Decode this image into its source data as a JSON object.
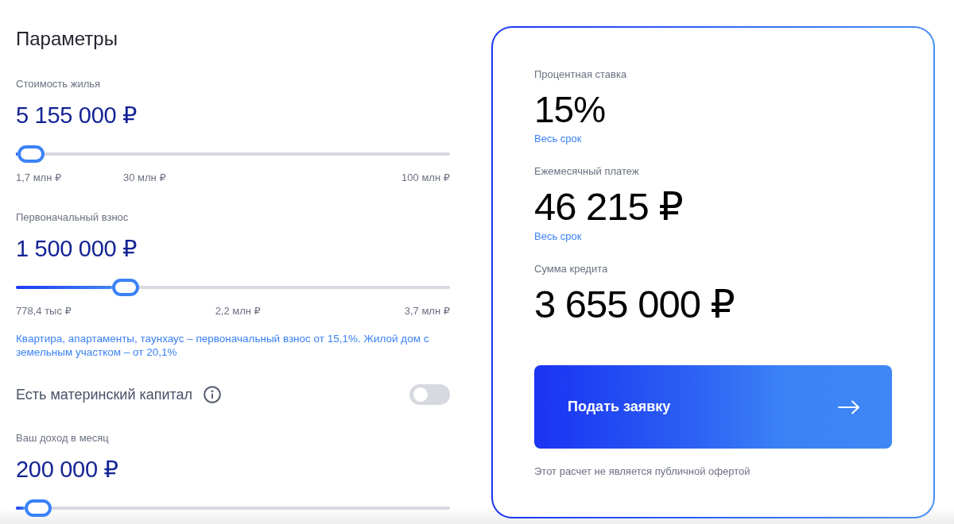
{
  "parameters": {
    "title": "Параметры",
    "items": [
      {
        "kind": "slider",
        "label": "Стоимость жилья",
        "value": "5 155 000 ₽",
        "level": 0.035,
        "ticks": [
          "1,7 млн ₽",
          "30 млн ₽",
          "100 млн ₽"
        ]
      },
      {
        "kind": "slider",
        "label": "Первоначальный взнос",
        "value": "1 500 000 ₽",
        "level": 0.253,
        "ticks": [
          "778,4 тыс ₽",
          "2,2 млн ₽",
          "3,7 млн ₽"
        ],
        "note": "Квартира, апартаменты, таунхаус – первоначальный взнос от 15,1%. Жилой дом с земельным участком – от 20,1%"
      },
      {
        "kind": "toggle",
        "label": "Есть материнский капитал",
        "on": false
      },
      {
        "kind": "slider",
        "label": "Ваш доход в месяц",
        "value": "200 000 ₽",
        "level": 0.051
      }
    ]
  },
  "summary": {
    "items": [
      {
        "label": "Процентная ставка",
        "value": "15%",
        "note": "Весь срок"
      },
      {
        "label": "Ежемесячный платеж",
        "value": "46 215 ₽",
        "note": "Весь срок"
      },
      {
        "label": "Сумма кредита",
        "value": "3 655 000 ₽"
      }
    ],
    "button": "Подать заявку",
    "disclaimer": "Этот расчет не является публичной офертой"
  }
}
